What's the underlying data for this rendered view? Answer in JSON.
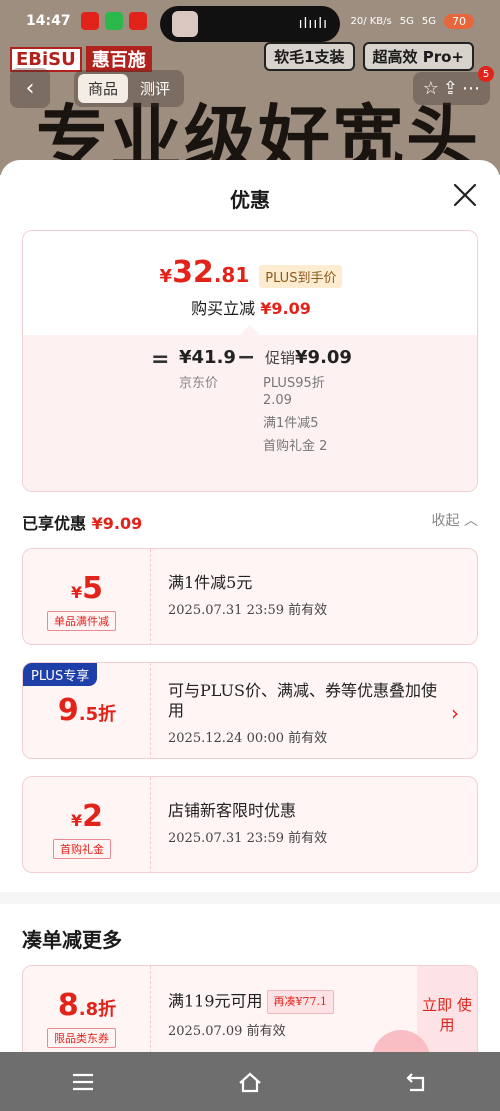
{
  "status": {
    "time": "14:47",
    "net_speed": "20/ KB/s",
    "sig1": "5G",
    "sig2": "5G",
    "battery": "70"
  },
  "product_bg": {
    "brand_a": "EBiSU",
    "brand_b": "惠百施",
    "spec_tags": [
      "软毛1支装",
      "超高效 Pro+"
    ],
    "tabs": [
      "商品",
      "测评"
    ],
    "slogan": "专业级好宽头",
    "cart_count": "5"
  },
  "sheet": {
    "title": "优惠",
    "summary": {
      "price_symbol": "¥",
      "price_int": "32",
      "price_dec": ".81",
      "price_tag": "PLUS到手价",
      "reduce_label": "购买立减",
      "reduce_amount": "¥9.09",
      "eq": "=",
      "minus": "−",
      "jd_price": "¥41.9",
      "jd_price_label": "京东价",
      "promo_label": "促销",
      "promo_amount": "¥9.09",
      "promo_lines": [
        "PLUS95折 2.09",
        "满1件减5",
        "首购礼金 2"
      ]
    },
    "enjoyed": {
      "label": "已享优惠",
      "amount": "¥9.09",
      "collapse": "收起"
    },
    "coupons": [
      {
        "sym": "¥",
        "num": "5",
        "sub": "",
        "type": "单品满件减",
        "title": "满1件减5元",
        "date": "2025.07.31 23:59 前有效"
      },
      {
        "badge": "PLUS专享",
        "sym": "",
        "num": "9",
        "sub": ".5折",
        "type": "",
        "title": "可与PLUS价、满减、券等优惠叠加使用",
        "date": "2025.12.24 00:00 前有效"
      },
      {
        "sym": "¥",
        "num": "2",
        "sub": "",
        "type": "首购礼金",
        "title": "店铺新客限时优惠",
        "date": "2025.07.31 23:59 前有效"
      }
    ],
    "more": {
      "title": "凑单减更多",
      "coupon": {
        "num": "8",
        "sub": ".8折",
        "type": "限品类东券",
        "title": "满119元可用",
        "again": "再凑¥77.1",
        "date": "2025.07.09 前有效",
        "action": "立即 使用"
      }
    }
  }
}
